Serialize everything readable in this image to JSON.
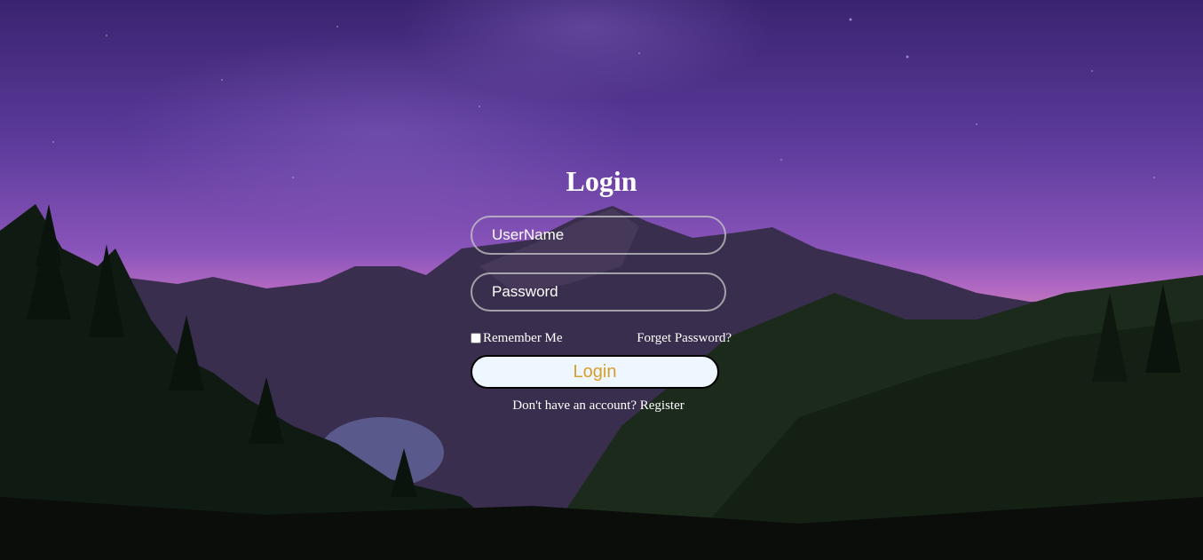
{
  "login": {
    "title": "Login",
    "username_placeholder": "UserName",
    "password_placeholder": "Password",
    "remember_label": "Remember Me",
    "remember_checked": false,
    "forgot_label": "Forget Password?",
    "submit_label": "Login",
    "no_account_text": "Don't have an account?",
    "register_label": "Register"
  },
  "colors": {
    "button_bg": "#eef6ff",
    "button_text": "#d6a02b",
    "text": "#ffffff"
  }
}
